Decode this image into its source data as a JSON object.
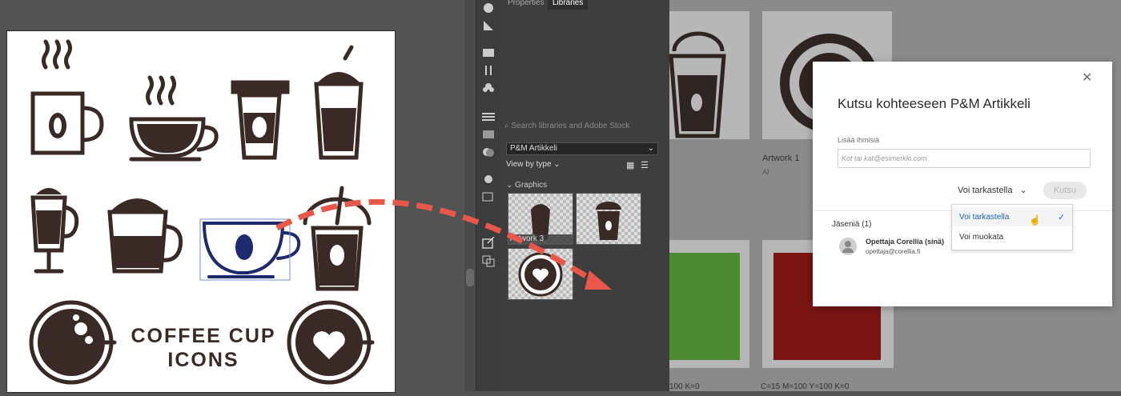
{
  "panel": {
    "tabs": [
      {
        "label": "Properties"
      },
      {
        "label": "Libraries"
      }
    ],
    "search_placeholder": "Search libraries and Adobe Stock",
    "library_select": "P&M Artikkeli",
    "view_by": "View by type",
    "section_label": "Graphics",
    "thumb_label": "Artwork 3"
  },
  "artboard": {
    "title_line1": "COFFEE CUP",
    "title_line2": "ICONS"
  },
  "web": {
    "card_title": "Artwork 1",
    "card_type": "AI",
    "swatch_caption_1": "100 K=0",
    "swatch_caption_2": "C=15 M=100 Y=100 K=0",
    "swatch_colors": [
      "#4e8a32",
      "#7a1513"
    ]
  },
  "dialog": {
    "title": "Kutsu kohteeseen P&M Artikkeli",
    "add_people_label": "Lisää ihmisiä",
    "email_placeholder": "Kot tai kat@esimerkki.com",
    "permission_value": "Voi tarkastella",
    "invite_button": "Kutsu",
    "members_label": "Jäseniä (1)",
    "member_name": "Opettaja Corellia (sinä)",
    "member_email": "opettaja@corellia.fi",
    "dropdown_options": [
      {
        "label": "Voi tarkastella",
        "selected": true
      },
      {
        "label": "Voi muokata",
        "selected": false
      }
    ]
  },
  "colors": {
    "ink": "#3a2a26",
    "accent_blue": "#1e63b4",
    "arrow_red": "#e8584a"
  }
}
